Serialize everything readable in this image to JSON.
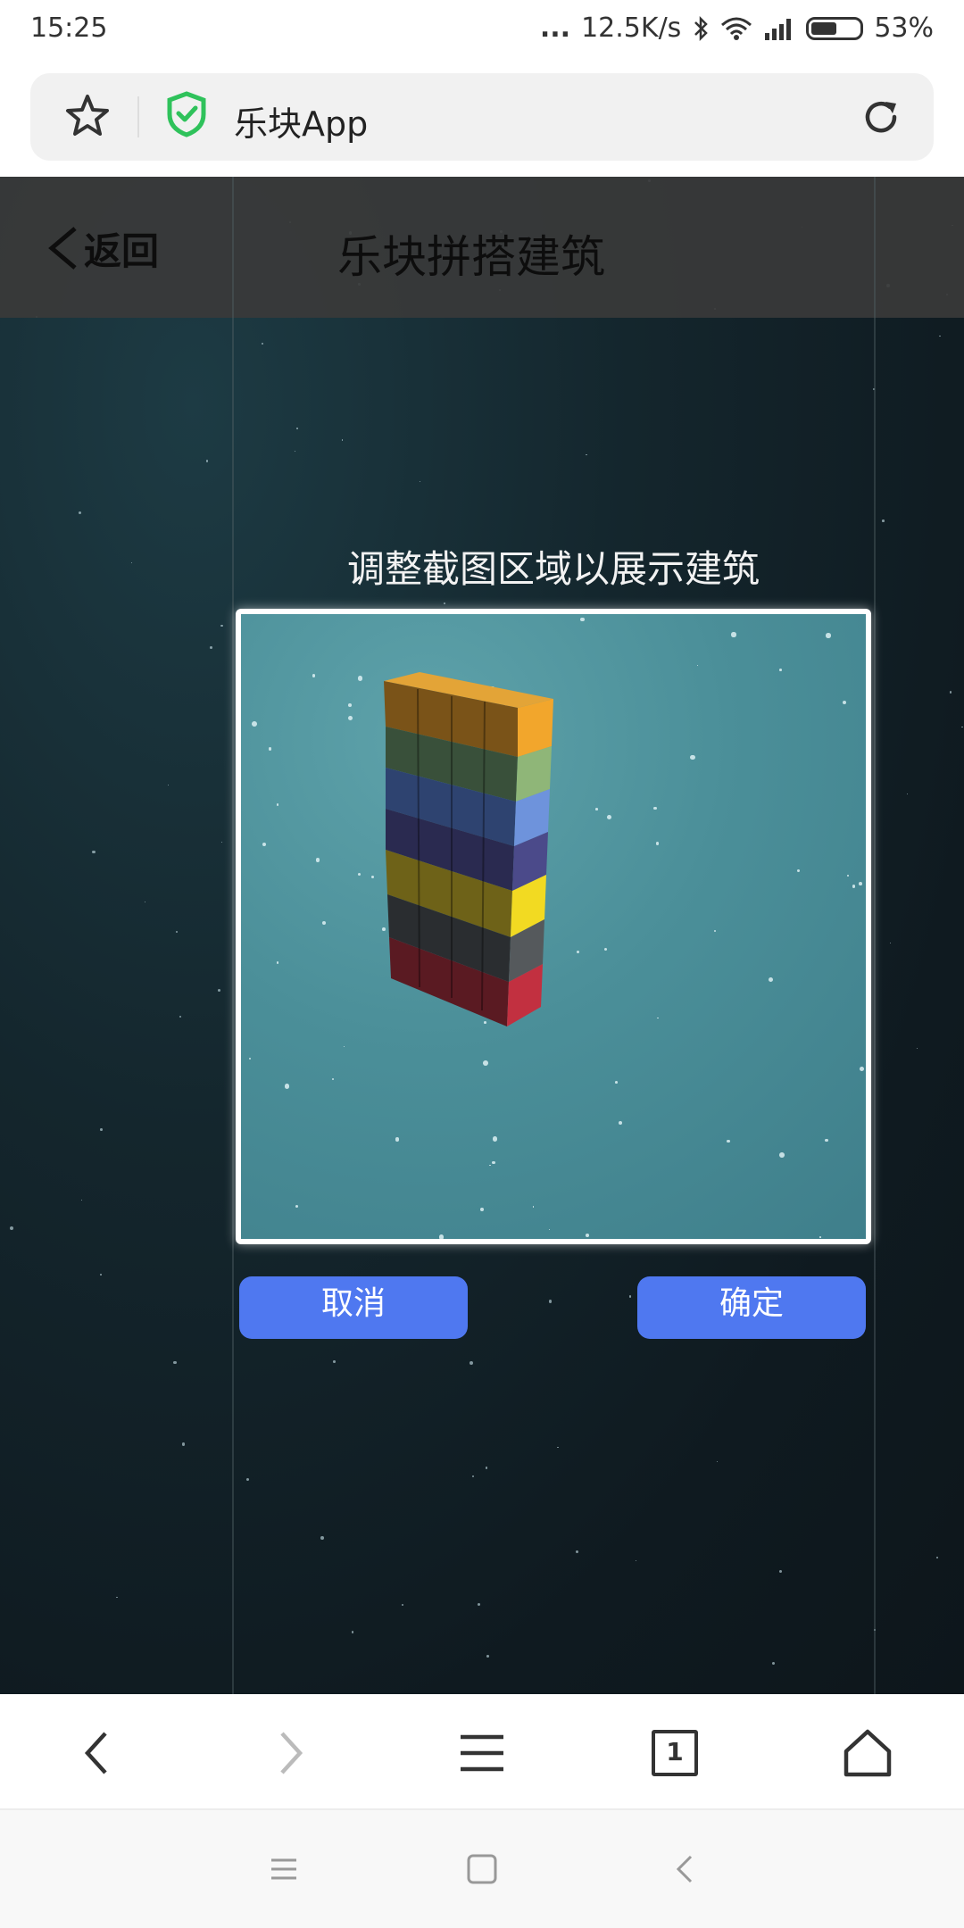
{
  "status_bar": {
    "time": "15:25",
    "dots": "...",
    "network_speed": "12.5K/s",
    "battery": "53%"
  },
  "browser": {
    "site_title": "乐块App",
    "icons": [
      "star-icon",
      "shield-icon",
      "reload-icon"
    ]
  },
  "app": {
    "back_label": "返回",
    "title": "乐块拼搭建筑",
    "instruction": "调整截图区域以展示建筑",
    "cancel_label": "取消",
    "confirm_label": "确定"
  },
  "bottom_nav": {
    "tab_count": "1",
    "icons": [
      "back-icon",
      "forward-icon",
      "menu-icon",
      "tabs-icon",
      "home-icon"
    ]
  },
  "system_nav": {
    "icons": [
      "recents-icon",
      "home-square-icon",
      "system-back-icon"
    ]
  },
  "colors": {
    "accent_button": "#4f78f0",
    "header_bg": "#3a3a3a",
    "page_bg": "#14262d",
    "crop_bg": "#4b8f99",
    "shield_green": "#2fc25b"
  }
}
